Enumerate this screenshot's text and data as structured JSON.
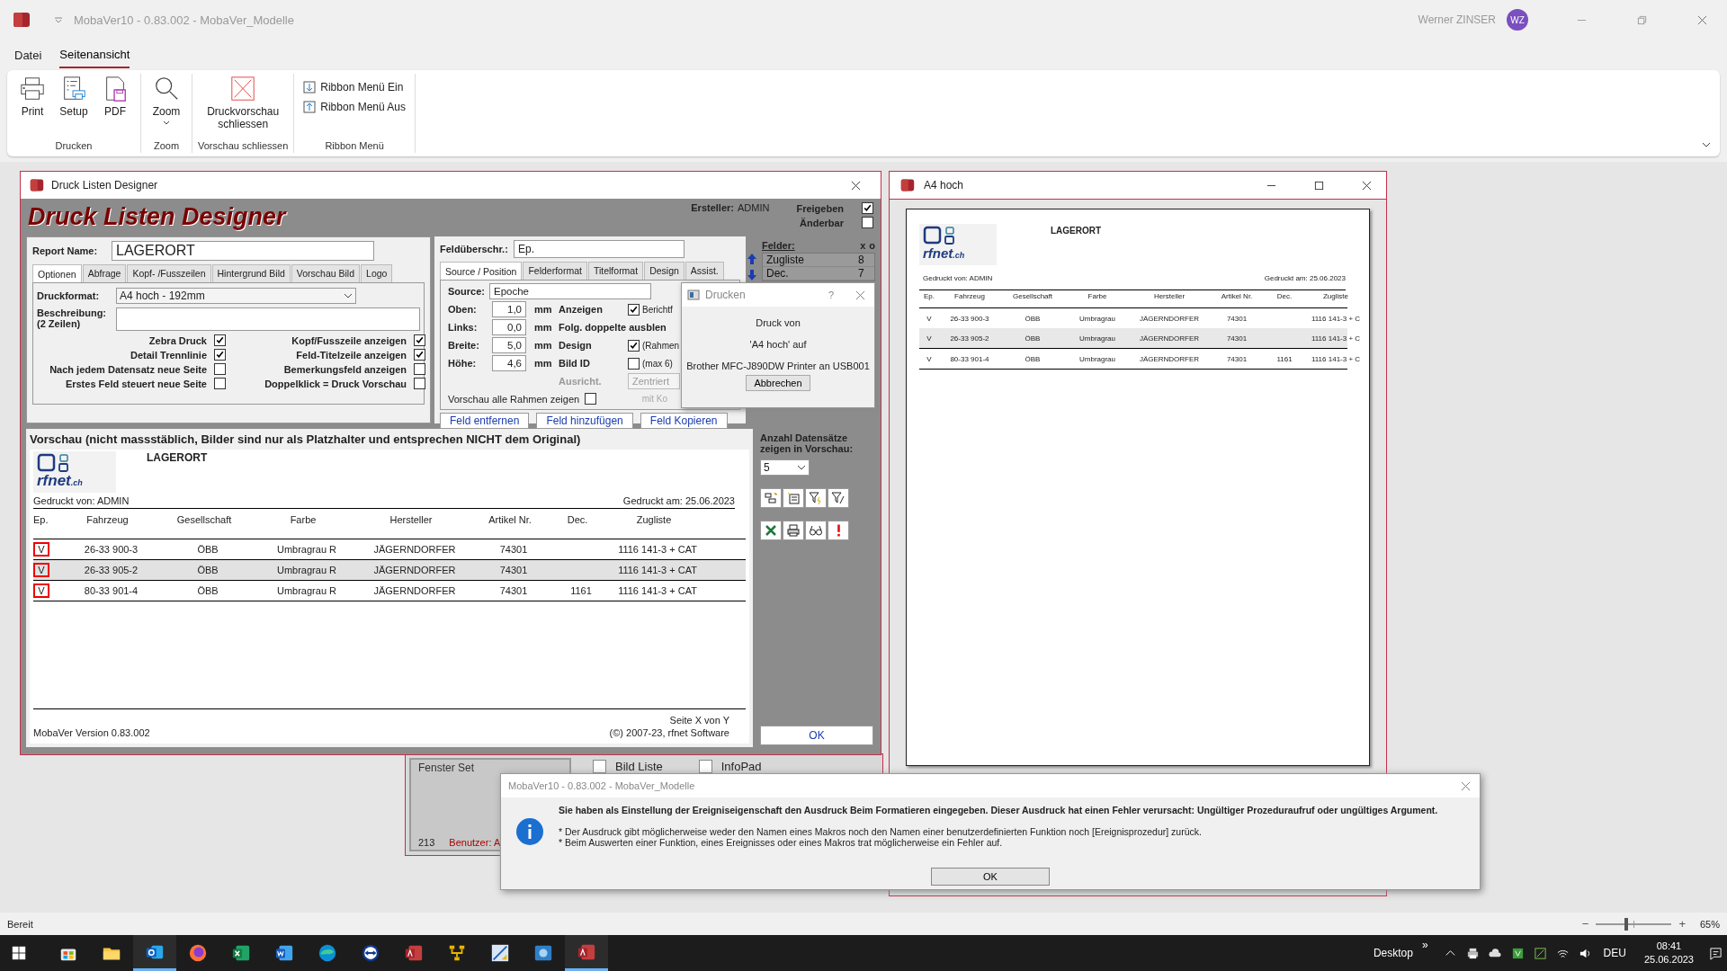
{
  "app": {
    "title": "MobaVer10 - 0.83.002 - MobaVer_Modelle",
    "user": "Werner ZINSER",
    "initials": "WZ"
  },
  "menu_tabs": [
    {
      "label": "Datei",
      "selected": false
    },
    {
      "label": "Seitenansicht",
      "selected": true
    }
  ],
  "ribbon_groups": [
    {
      "label": "Drucken",
      "buttons": [
        {
          "kind": "large",
          "label": "Print"
        },
        {
          "kind": "large",
          "label": "Setup"
        },
        {
          "kind": "large",
          "label": "PDF"
        }
      ]
    },
    {
      "label": "Zoom",
      "buttons": [
        {
          "kind": "dropdown",
          "label": "Zoom"
        }
      ]
    },
    {
      "label": "Vorschau schliessen",
      "buttons": [
        {
          "kind": "large",
          "label": "Druckvorschau schliessen"
        }
      ]
    },
    {
      "label": "Ribbon Menü",
      "buttons": [
        {
          "kind": "small",
          "label": "Ribbon Menü Ein"
        },
        {
          "kind": "small",
          "label": "Ribbon Menü Aus"
        }
      ]
    }
  ],
  "designer": {
    "title": "Druck Listen Designer",
    "heading": "Druck Listen Designer",
    "creator_label": "Ersteller:",
    "creator": "ADMIN",
    "flags": [
      {
        "label": "Freigeben",
        "checked": true
      },
      {
        "label": "Änderbar",
        "checked": false
      }
    ],
    "report_name_label": "Report Name:",
    "report_name": "LAGERORT",
    "tabs": [
      {
        "label": "Optionen",
        "selected": true
      },
      {
        "label": "Abfrage",
        "selected": false
      },
      {
        "label": "Kopf- /Fusszeilen",
        "selected": false
      },
      {
        "label": "Hintergrund Bild",
        "selected": false
      },
      {
        "label": "Vorschau Bild",
        "selected": false
      },
      {
        "label": "Logo",
        "selected": false
      }
    ],
    "format_label": "Druckformat:",
    "format": "A4 hoch - 192mm",
    "description_label": [
      "Beschreibung:",
      "(2 Zeilen)"
    ],
    "options": [
      {
        "label": "Zebra Druck",
        "checked": true
      },
      {
        "label": "Kopf/Fusszeile anzeigen",
        "checked": true
      },
      {
        "label": "Detail Trennlinie",
        "checked": true
      },
      {
        "label": "Feld-Titelzeile anzeigen",
        "checked": true
      },
      {
        "label": "Nach jedem Datensatz neue Seite",
        "checked": false
      },
      {
        "label": "Bemerkungsfeld anzeigen",
        "checked": false
      },
      {
        "label": "Erstes Feld steuert neue Seite",
        "checked": false
      },
      {
        "label": "Doppelklick = Druck Vorschau",
        "checked": false
      }
    ],
    "field_label": "Feldüberschr.:",
    "field_value": "Ep.",
    "field_tabs": [
      {
        "label": "Source / Position",
        "selected": true
      },
      {
        "label": "Felderformat",
        "selected": false
      },
      {
        "label": "Titelformat",
        "selected": false
      },
      {
        "label": "Design",
        "selected": false
      },
      {
        "label": "Assist.",
        "selected": false
      }
    ],
    "source_label": "Source:",
    "source": "Epoche",
    "positions": [
      {
        "label": "Oben:",
        "value": "1,0",
        "unit": "mm"
      },
      {
        "label": "Links:",
        "value": "0,0",
        "unit": "mm"
      },
      {
        "label": "Breite:",
        "value": "5,0",
        "unit": "mm"
      },
      {
        "label": "Höhe:",
        "value": "4,6",
        "unit": "mm"
      }
    ],
    "properties": [
      {
        "kind": "check",
        "label": "Anzeigen",
        "checked": true,
        "text": "Berichtf"
      },
      {
        "kind": "label",
        "label": "Folg. doppelte ausblen"
      },
      {
        "kind": "check",
        "label": "Design",
        "checked": true,
        "text": "(Rahmen"
      },
      {
        "kind": "check",
        "label": "Bild ID",
        "checked": false,
        "text": "(max 6)"
      }
    ],
    "alignment_label": "Ausricht.",
    "alignment": "Zentriert",
    "copy_hint": "mit Ko",
    "preview_frames": {
      "label": "Vorschau alle Rahmen zeigen",
      "checked": false
    },
    "field_buttons": [
      "Feld entfernen",
      "Feld hinzufügen",
      "Feld Kopieren"
    ],
    "fields_label": "Felder:",
    "fields_markers": [
      "x",
      "o"
    ],
    "fields": [
      {
        "name": "Zugliste",
        "number": "8"
      },
      {
        "name": "Dec.",
        "number": "7"
      }
    ],
    "preview_heading": "Vorschau (nicht massstäblich, Bilder sind nur als Platzhalter und entsprechen NICHT dem Original)",
    "count_label": "Anzahl Datensätze zeigen in Vorschau:",
    "count": "5",
    "ok": "OK"
  },
  "report": {
    "logo": "rfnet",
    "logo_suffix": ".ch",
    "title": "LAGERORT",
    "printed_by": "Gedruckt von: ADMIN",
    "printed_on": "Gedruckt am: 25.06.2023",
    "columns": [
      "Ep.",
      "Fahrzeug",
      "Gesellschaft",
      "Farbe",
      "Hersteller",
      "Artikel Nr.",
      "Dec.",
      "Zugliste"
    ],
    "rows": [
      {
        "ep": "V",
        "fahrzeug": "26-33 900-3",
        "gesellschaft": "ÖBB",
        "farbe": "Umbragrau R",
        "hersteller": "JÄGERNDORFER",
        "artikel": "74301",
        "zugliste": "1116 141-3 + CAT",
        "shaded": false
      },
      {
        "ep": "V",
        "fahrzeug": "26-33 905-2",
        "gesellschaft": "ÖBB",
        "farbe": "Umbragrau R",
        "hersteller": "JÄGERNDORFER",
        "artikel": "74301",
        "zugliste": "1116 141-3 + CAT",
        "shaded": true
      },
      {
        "ep": "V",
        "fahrzeug": "80-33 901-4",
        "gesellschaft": "ÖBB",
        "farbe": "Umbragrau R",
        "hersteller": "JÄGERNDORFER",
        "artikel": "74301",
        "dec": "1161",
        "zugliste": "1116 141-3 + CAT",
        "shaded": false
      }
    ],
    "page": "Seite X von Y",
    "version": "MobaVer Version 0.83.002",
    "copyright": "(©) 2007-23, rfnet Software"
  },
  "a4": {
    "title": "A4 hoch",
    "logo": "rfnet",
    "logo_suffix": ".ch",
    "report_title": "LAGERORT",
    "printed_by": "Gedruckt von: ADMIN",
    "printed_on": "Gedruckt am: 25.06.2023",
    "columns": [
      "Ep.",
      "Fahrzeug",
      "Gesellschaft",
      "Farbe",
      "Hersteller",
      "Artikel Nr.",
      "Dec.",
      "Zugliste"
    ],
    "rows": [
      {
        "ep": "V",
        "fahrzeug": "26-33 900-3",
        "gesellschaft": "ÖBB",
        "farbe": "Umbragrau",
        "hersteller": "JÄGERNDORFER",
        "artikel": "74301",
        "zugliste": "1116 141-3 + C",
        "shaded": false
      },
      {
        "ep": "V",
        "fahrzeug": "26-33 905-2",
        "gesellschaft": "ÖBB",
        "farbe": "Umbragrau",
        "hersteller": "JÄGERNDORFER",
        "artikel": "74301",
        "zugliste": "1116 141-3 + C",
        "shaded": true
      },
      {
        "ep": "V",
        "fahrzeug": "80-33 901-4",
        "gesellschaft": "ÖBB",
        "farbe": "Umbragrau",
        "hersteller": "JÄGERNDORFER",
        "artikel": "74301",
        "dec": "1161",
        "zugliste": "1116 141-3 + C",
        "shaded": false
      }
    ]
  },
  "print_dialog": {
    "title": "Drucken",
    "help": "?",
    "lines": [
      "Druck von",
      "'A4 hoch' auf",
      "Brother MFC-J890DW Printer an USB001"
    ],
    "button": "Abbrechen"
  },
  "back_window": {
    "label": "Fenster Set",
    "checks": [
      {
        "label": "Bild Liste",
        "checked": false
      },
      {
        "label": "InfoPad",
        "checked": false
      }
    ],
    "number": "213",
    "user": "Benutzer: A"
  },
  "error_dialog": {
    "title": "MobaVer10 - 0.83.002 - MobaVer_Modelle",
    "message": "Sie haben als Einstellung der Ereigniseigenschaft den Ausdruck Beim Formatieren eingegeben. Dieser Ausdruck hat einen Fehler verursacht: Ungültiger Prozeduraufruf oder ungültiges Argument.",
    "details": [
      "* Der Ausdruck gibt möglicherweise weder den Namen eines Makros noch den Namen einer benutzerdefinierten Funktion noch [Ereignisprozedur] zurück.",
      "* Beim Auswerten einer Funktion, eines Ereignisses oder eines Makros trat möglicherweise ein Fehler auf."
    ],
    "button": "OK"
  },
  "status_bar": {
    "text": "Bereit",
    "zoom_out": "−",
    "zoom_in": "+",
    "zoom_slider": {
      "level": 0.4
    },
    "zoom": "65%"
  },
  "taskbar": {
    "apps": [
      {
        "kind": "store",
        "selected": false
      },
      {
        "kind": "folder",
        "selected": false
      },
      {
        "kind": "mail",
        "selected": true
      },
      {
        "kind": "fox",
        "selected": false
      },
      {
        "kind": "sheet",
        "selected": false
      },
      {
        "kind": "doc",
        "selected": false
      },
      {
        "kind": "edge",
        "selected": false
      },
      {
        "kind": "remote",
        "selected": false
      },
      {
        "kind": "db",
        "selected": false
      },
      {
        "kind": "net",
        "selected": false
      },
      {
        "kind": "chart",
        "selected": false
      },
      {
        "kind": "photo",
        "selected": false
      },
      {
        "kind": "db",
        "selected": true
      }
    ],
    "desktop": "Desktop",
    "chevron": "»",
    "lang": "DEU",
    "time": "08:41",
    "date": "25.06.2023"
  }
}
